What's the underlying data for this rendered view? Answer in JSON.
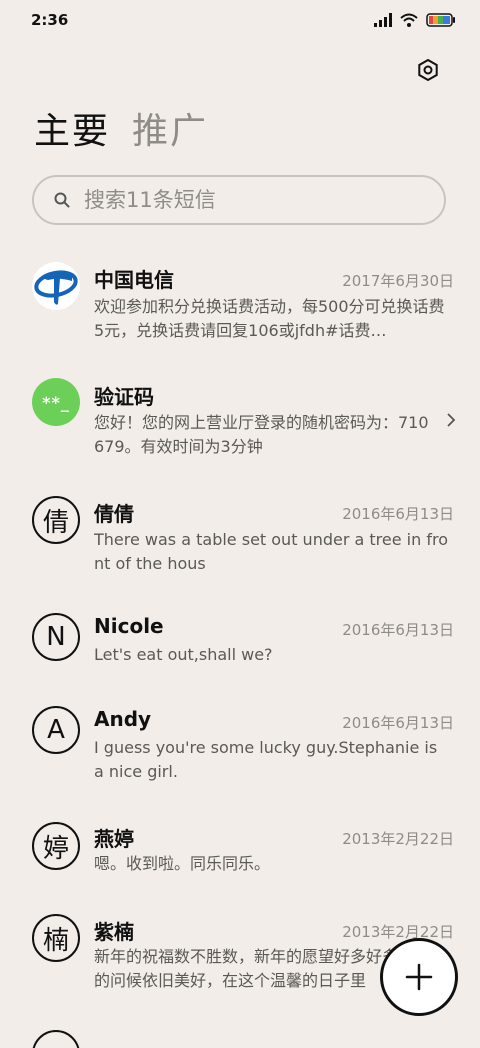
{
  "status_bar": {
    "time": "2:36",
    "icons": [
      "signal-icon",
      "wifi-icon",
      "battery-icon"
    ]
  },
  "header": {
    "settings_icon": "settings-icon",
    "tabs": [
      {
        "label": "主要",
        "active": true
      },
      {
        "label": "推广",
        "active": false
      }
    ]
  },
  "search": {
    "placeholder": "搜索11条短信"
  },
  "conversations": [
    {
      "avatar": "telecom-logo",
      "name": "中国电信",
      "date": "2017年6月30日",
      "preview": "欢迎参加积分兑换话费活动，每500分可兑换话费5元，兑换话费请回复106或jfdh#话费…"
    },
    {
      "avatar_text": "**_",
      "name": "验证码",
      "date": "",
      "preview": "您好！您的网上营业厅登录的随机密码为：710679。有效时间为3分钟"
    },
    {
      "avatar_text": "倩",
      "name": "倩倩",
      "date": "2016年6月13日",
      "preview": "There was a table set out under a tree in front of the hous"
    },
    {
      "avatar_text": "N",
      "name": "Nicole",
      "date": "2016年6月13日",
      "preview": "Let's eat out,shall we?"
    },
    {
      "avatar_text": "A",
      "name": "Andy",
      "date": "2016年6月13日",
      "preview": "I guess you're some lucky guy.Stephanie is a nice girl."
    },
    {
      "avatar_text": "婷",
      "name": "燕婷",
      "date": "2013年2月22日",
      "preview": "嗯。收到啦。同乐同乐。"
    },
    {
      "avatar_text": "楠",
      "name": "紫楠",
      "date": "2013年2月22日",
      "preview": "新年的祝福数不胜数，新年的愿望好多好多，新年的问候依旧美好，在这个温馨的日子里"
    }
  ],
  "colors": {
    "background": "#f2ede8",
    "accent_green": "#6cd058",
    "telecom_blue": "#1465b8",
    "secondary_text": "#8f8c88"
  },
  "fab": {
    "icon": "plus-icon"
  }
}
